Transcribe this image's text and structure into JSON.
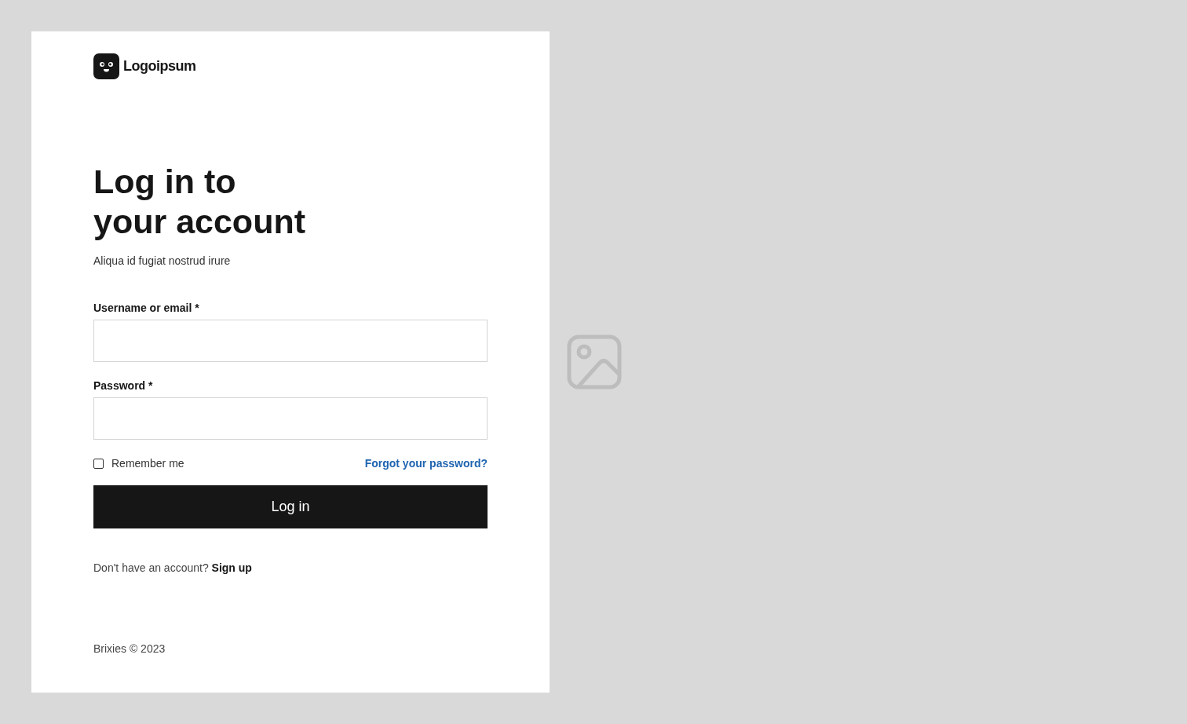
{
  "logo": {
    "name": "Logoipsum"
  },
  "heading": "Log in to your account",
  "subtitle": "Aliqua id fugiat nostrud irure",
  "fields": [
    {
      "label": "Username or email *"
    },
    {
      "label": "Password *"
    }
  ],
  "remember": {
    "label": "Remember me",
    "checked": false
  },
  "forgot_link": "Forgot your password?",
  "submit": "Log in",
  "signup": {
    "text": "Don't have an account?",
    "link": "Sign up"
  },
  "footer": "Brixies © 2023"
}
